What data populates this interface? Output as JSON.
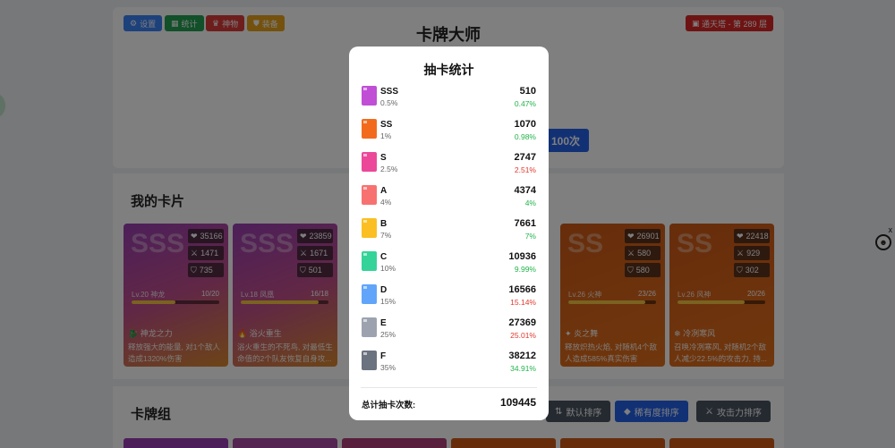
{
  "header": {
    "nav": [
      {
        "icon": "gear-icon",
        "label": "设置"
      },
      {
        "icon": "chart-icon",
        "label": "统计"
      },
      {
        "icon": "artifact-icon",
        "label": "神物"
      },
      {
        "icon": "armor-icon",
        "label": "装备"
      }
    ],
    "title": "卡牌大师",
    "tower_badge": "通天塔 - 第 289 层",
    "draw_button_partial": "100次"
  },
  "my_cards": {
    "title": "我的卡片",
    "cards": [
      {
        "rank": "SSS",
        "hp": "35166",
        "atk": "1471",
        "def": "735",
        "level": "Lv.20 神龙",
        "progress": "10/20",
        "progress_ratio": 0.5,
        "skill": "神龙之力",
        "desc": "释放强大的能量, 对1个敌人造成1320%伤害"
      },
      {
        "rank": "SSS",
        "hp": "23859",
        "atk": "1671",
        "def": "501",
        "level": "Lv.18 凤凰",
        "progress": "16/18",
        "progress_ratio": 0.89,
        "skill": "浴火重生",
        "desc": "浴火重生的不死鸟, 对最低生命值的2个队友恢复自身攻..."
      },
      {
        "rank": "SS",
        "hp": "26901",
        "atk": "580",
        "def": "580",
        "level": "Lv.26 火神",
        "progress": "23/26",
        "progress_ratio": 0.88,
        "skill": "炎之舞",
        "desc": "释放炽热火焰, 对随机4个敌人造成585%真实伤害"
      },
      {
        "rank": "SS",
        "hp": "22418",
        "atk": "929",
        "def": "302",
        "level": "Lv.26 风神",
        "progress": "20/26",
        "progress_ratio": 0.77,
        "skill": "冷冽寒风",
        "desc": "召唤冷冽寒风, 对随机2个敌人减少22.5%的攻击力, 持..."
      }
    ]
  },
  "deck": {
    "title": "卡牌组",
    "sort_buttons": {
      "default": "默认排序",
      "rarity": "稀有度排序",
      "attack": "攻击力排序"
    }
  },
  "close_label": "x",
  "modal": {
    "title": "抽卡统计",
    "rows": [
      {
        "rarity": "SSS",
        "prob": "0.5%",
        "count": "510",
        "pct": "0.47%",
        "trend": "up",
        "color": "#c04fd6"
      },
      {
        "rarity": "SS",
        "prob": "1%",
        "count": "1070",
        "pct": "0.98%",
        "trend": "up",
        "color": "#f26b1d"
      },
      {
        "rarity": "S",
        "prob": "2.5%",
        "count": "2747",
        "pct": "2.51%",
        "trend": "down",
        "color": "#ec4899"
      },
      {
        "rarity": "A",
        "prob": "4%",
        "count": "4374",
        "pct": "4%",
        "trend": "up",
        "color": "#f87171"
      },
      {
        "rarity": "B",
        "prob": "7%",
        "count": "7661",
        "pct": "7%",
        "trend": "up",
        "color": "#fbbf24"
      },
      {
        "rarity": "C",
        "prob": "10%",
        "count": "10936",
        "pct": "9.99%",
        "trend": "up",
        "color": "#34d399"
      },
      {
        "rarity": "D",
        "prob": "15%",
        "count": "16566",
        "pct": "15.14%",
        "trend": "down",
        "color": "#60a5fa"
      },
      {
        "rarity": "E",
        "prob": "25%",
        "count": "27369",
        "pct": "25.01%",
        "trend": "down",
        "color": "#9ca3af"
      },
      {
        "rarity": "F",
        "prob": "35%",
        "count": "38212",
        "pct": "34.91%",
        "trend": "up",
        "color": "#6b7280"
      }
    ],
    "total_label": "总计抽卡次数:",
    "total_value": "109445"
  }
}
